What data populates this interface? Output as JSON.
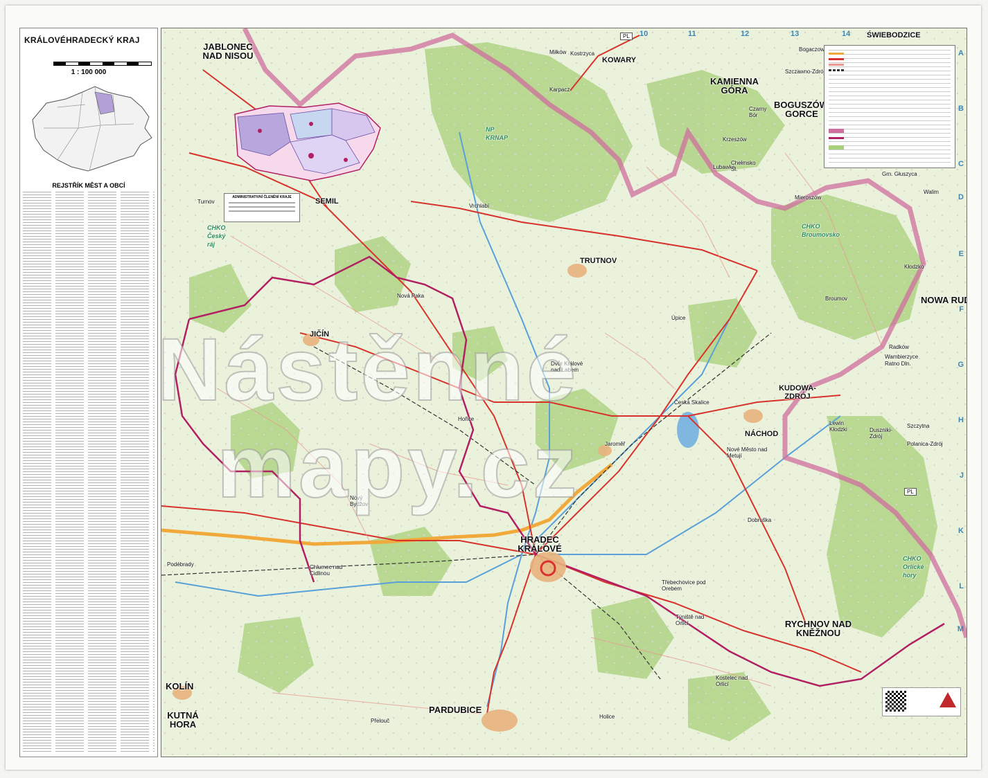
{
  "sidebar": {
    "title": "KRÁLOVÉHRADECKÝ KRAJ",
    "scale": "1 : 100 000",
    "index_title": "REJSTŘÍK MĚST A OBCÍ"
  },
  "map": {
    "cities_major": [
      {
        "name": "HRADEC KRÁLOVÉ"
      },
      {
        "name": "PARDUBICE"
      },
      {
        "name": "JABLONEC NAD NISOU"
      },
      {
        "name": "KAMIENNA GÓRA"
      },
      {
        "name": "BOGUSZÓW-GORCE"
      },
      {
        "name": "RYCHNOV NAD KNĚŽNOU"
      },
      {
        "name": "KUTNÁ HORA"
      },
      {
        "name": "KOLÍN"
      },
      {
        "name": "NOWA RUDA"
      }
    ],
    "cities": [
      {
        "name": "TRUTNOV"
      },
      {
        "name": "NÁCHOD"
      },
      {
        "name": "JIČÍN"
      },
      {
        "name": "SEMIL"
      },
      {
        "name": "KOWARY"
      },
      {
        "name": "ŚWIEBODZICE"
      },
      {
        "name": "KUDOWA-ZDRÓJ"
      }
    ],
    "towns": [
      {
        "name": "Turnov"
      },
      {
        "name": "Vrchlabí"
      },
      {
        "name": "Jaroměř"
      },
      {
        "name": "Dvůr Králové nad Labem"
      },
      {
        "name": "Nové Město nad Metují"
      },
      {
        "name": "Česká Skalice"
      },
      {
        "name": "Broumov"
      },
      {
        "name": "Úpice"
      },
      {
        "name": "Podébrady"
      },
      {
        "name": "Chlumec nad Cidlinou"
      },
      {
        "name": "Nový Bydžov"
      },
      {
        "name": "Hořice"
      },
      {
        "name": "Kostelec nad Orlicí"
      },
      {
        "name": "Holice"
      },
      {
        "name": "Přelouč"
      },
      {
        "name": "Dobruška"
      },
      {
        "name": "Týniště nad Orlicí"
      },
      {
        "name": "Třebechovice pod Orebem"
      },
      {
        "name": "Nová Paka"
      },
      {
        "name": "Lubawka"
      },
      {
        "name": "Kłodzko"
      },
      {
        "name": "Radków"
      },
      {
        "name": "Polanica-Zdrój"
      },
      {
        "name": "Duszniki-Zdrój"
      },
      {
        "name": "Szczytna"
      },
      {
        "name": "Lewin Kłodzki"
      },
      {
        "name": "Walim"
      },
      {
        "name": "Grn. Głuszyca"
      },
      {
        "name": "Mieroszów"
      },
      {
        "name": "Krzeszów"
      },
      {
        "name": "Karpacz"
      },
      {
        "name": "Kostrzyca"
      },
      {
        "name": "Miłków"
      },
      {
        "name": "Chełmsko Śl."
      },
      {
        "name": "Czarny Bór"
      },
      {
        "name": "Bogaczowice"
      },
      {
        "name": "Szczawno-Zdrój"
      },
      {
        "name": "Wambierzyce"
      },
      {
        "name": "Ratno Dln."
      }
    ],
    "parks": [
      {
        "name": "NP KRNAP"
      },
      {
        "name": "CHKO Český ráj"
      },
      {
        "name": "CHKO Broumovsko"
      },
      {
        "name": "CHKO Orlické hory"
      }
    ],
    "country_codes": [
      {
        "name": "PL"
      },
      {
        "name": "PL"
      }
    ],
    "grid_cols": [
      "10",
      "11",
      "12",
      "13",
      "14"
    ],
    "grid_rows": [
      "A",
      "B",
      "C",
      "D",
      "E",
      "F",
      "G",
      "H",
      "J",
      "K",
      "L",
      "M"
    ],
    "admin_legend_title": "ADMINISTRATIVNÍ ČLENĚNÍ KRAJE",
    "colors": {
      "border_state": "#cf6f9e",
      "border_region": "#b21f62",
      "motorway": "#f2a93b",
      "road": "#d8322c",
      "river": "#5aa0d8",
      "forest": "#a8cf7a"
    }
  },
  "watermark": {
    "line1": "Nástěnné",
    "line2": "mapy.cz"
  }
}
